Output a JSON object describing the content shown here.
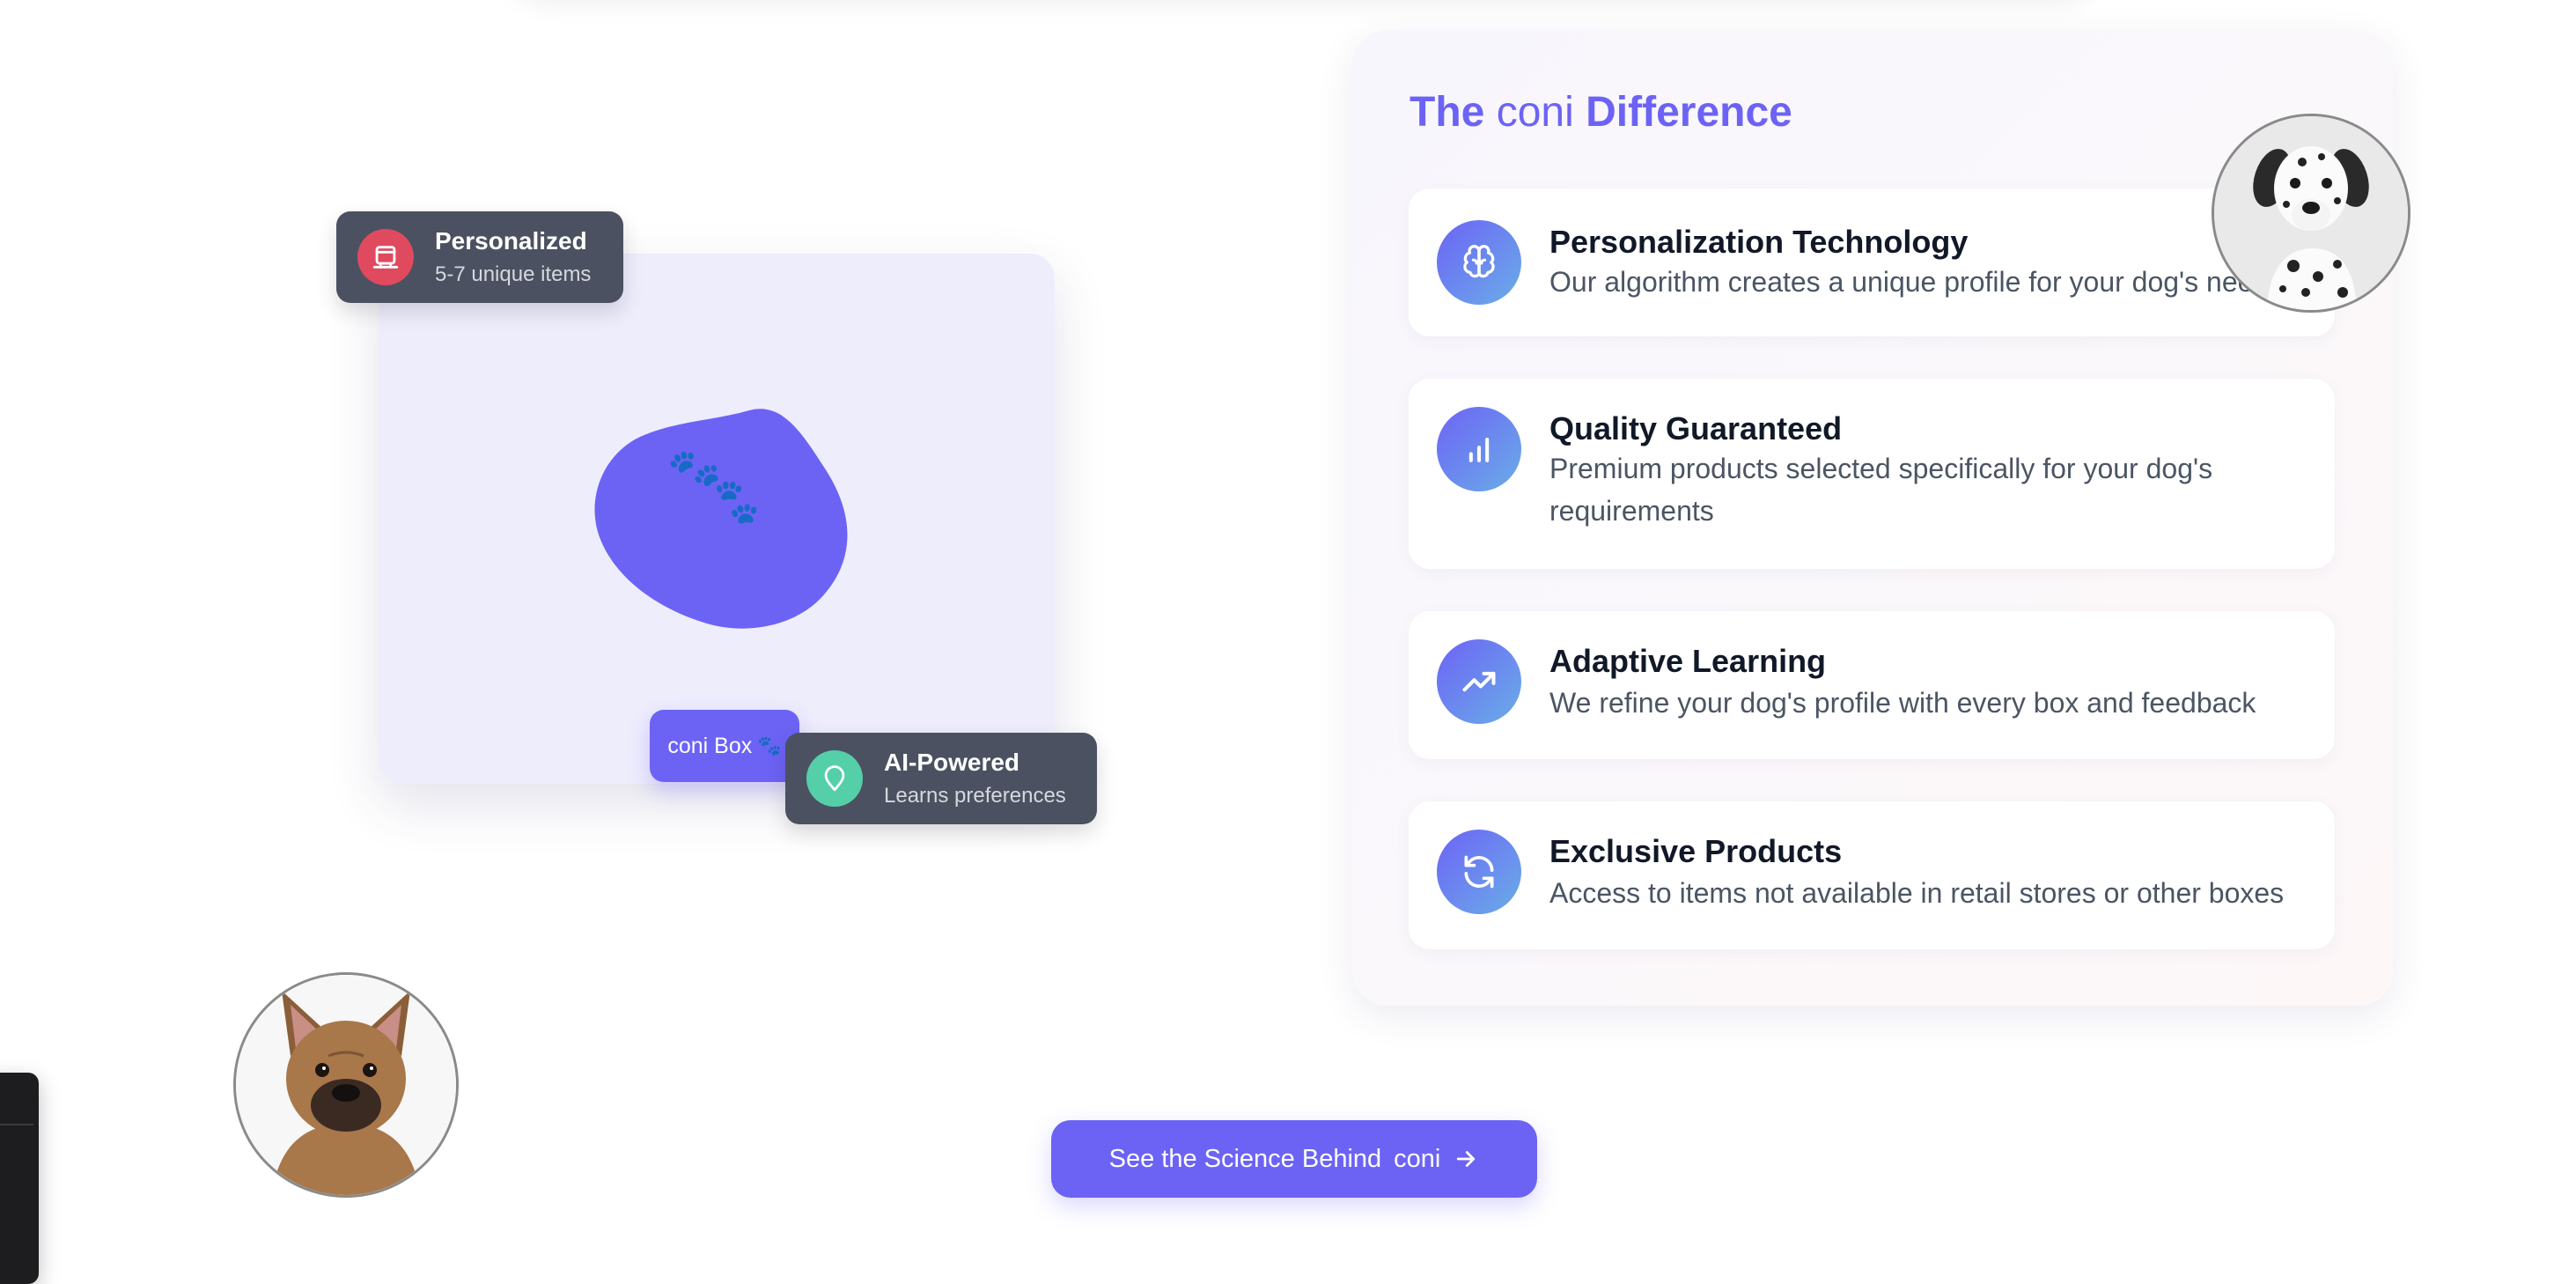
{
  "illustration": {
    "tooltip_personalized": {
      "title": "Personalized",
      "subtitle": "5-7 unique items",
      "icon": "box-icon"
    },
    "tooltip_ai": {
      "title": "AI-Powered",
      "subtitle": "Learns preferences",
      "icon": "location-pin-icon"
    },
    "badge": {
      "label": "coni Box",
      "icon": "paw-icon"
    },
    "blob_color": "#6c63f5",
    "card_color": "#eeedfc"
  },
  "difference": {
    "title_prefix": "The",
    "title_brand": "coni",
    "title_suffix": "Difference",
    "features": [
      {
        "title": "Personalization Technology",
        "description": "Our algorithm creates a unique profile for your dog's needs",
        "icon": "brain-icon"
      },
      {
        "title": "Quality Guaranteed",
        "description": "Premium products selected specifically for your dog's requirements",
        "icon": "bar-chart-icon"
      },
      {
        "title": "Adaptive Learning",
        "description": "We refine your dog's profile with every box and feedback",
        "icon": "trending-up-icon"
      },
      {
        "title": "Exclusive Products",
        "description": "Access to items not available in retail stores or other boxes",
        "icon": "refresh-icon"
      }
    ]
  },
  "cta": {
    "label": "See the Science Behind",
    "brand": "coni",
    "icon": "arrow-right-icon"
  },
  "colors": {
    "accent": "#6c63f5",
    "tooltip_bg": "#4b5160",
    "icon_red": "#e04a5f",
    "icon_teal": "#54cfa8"
  }
}
